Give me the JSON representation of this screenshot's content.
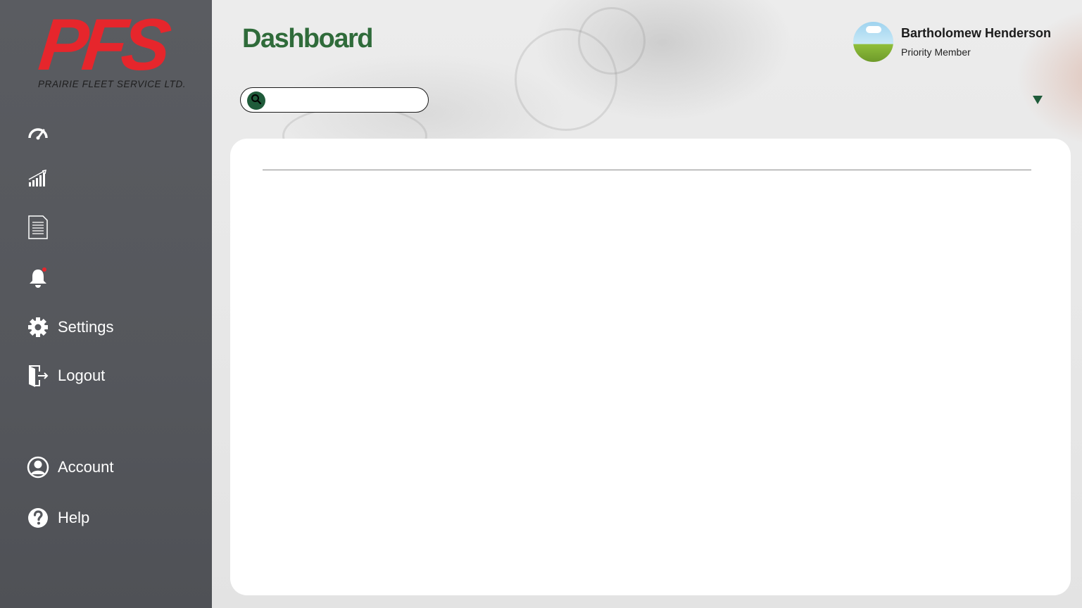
{
  "app": {
    "logo_text": "PFS",
    "logo_subtitle": "PRAIRIE FLEET SERVICE LTD.",
    "brand_red": "#e6262c",
    "brand_green": "#2f6b3a"
  },
  "header": {
    "title": "Dashboard"
  },
  "search": {
    "value": "",
    "placeholder": ""
  },
  "user": {
    "name": "Bartholomew Henderson",
    "role": "Priority Member"
  },
  "sidebar": {
    "items": [
      {
        "icon": "speedometer-icon",
        "label": ""
      },
      {
        "icon": "bar-chart-icon",
        "label": ""
      },
      {
        "icon": "document-icon",
        "label": ""
      },
      {
        "icon": "bell-icon",
        "label": "",
        "has_badge": true
      },
      {
        "icon": "gear-icon",
        "label": "Settings"
      },
      {
        "icon": "logout-icon",
        "label": "Logout"
      },
      {
        "icon": "account-icon",
        "label": "Account"
      },
      {
        "icon": "help-icon",
        "label": "Help"
      }
    ]
  }
}
